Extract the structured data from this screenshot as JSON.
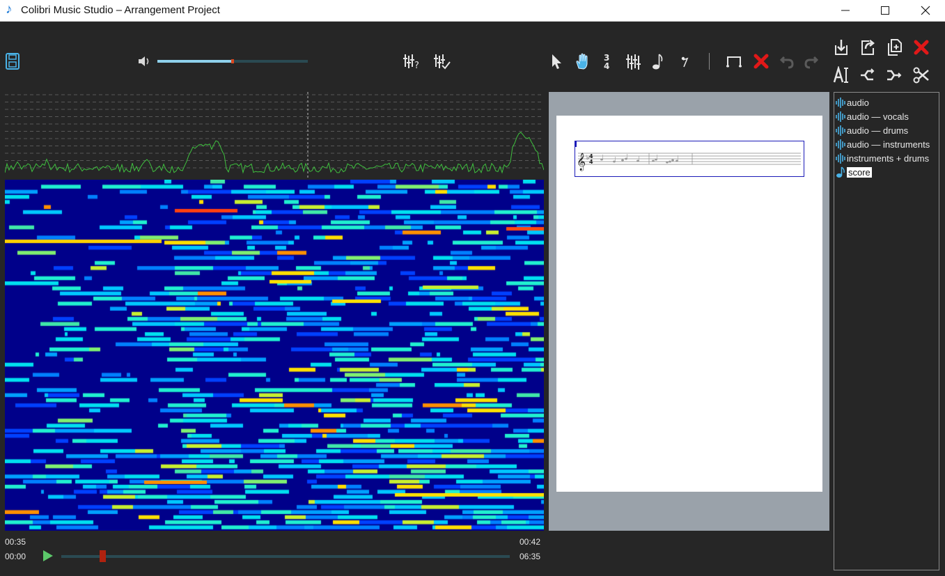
{
  "window": {
    "title": "Colibri Music Studio – Arrangement Project",
    "app_icon": "music-note-icon",
    "controls": [
      "minimize-icon",
      "maximize-icon",
      "close-icon"
    ]
  },
  "toolbar": {
    "volume_level": 0.5,
    "left_icons": [
      "save-icon",
      "volume-icon"
    ],
    "center_icons": [
      "tune-question-icon",
      "tune-check-icon"
    ],
    "tools": [
      "pointer-tool-icon",
      "hand-tool-icon",
      "time-signature-icon",
      "key-signature-icon",
      "note-icon",
      "rest-icon",
      "beam-icon",
      "delete-icon",
      "undo-icon",
      "redo-icon"
    ]
  },
  "right_toolbar": {
    "row1": [
      "import-icon",
      "export-icon",
      "copy-file-icon",
      "remove-icon"
    ],
    "row2": [
      "text-cursor-icon",
      "merge-icon",
      "split-icon",
      "cut-icon"
    ]
  },
  "tree": {
    "items": [
      {
        "label": "audio",
        "icon": "waveform-icon"
      },
      {
        "label": "audio — vocals",
        "icon": "waveform-icon"
      },
      {
        "label": "audio — drums",
        "icon": "waveform-icon"
      },
      {
        "label": "audio — instruments",
        "icon": "waveform-icon"
      },
      {
        "label": "instruments + drums",
        "icon": "waveform-icon"
      },
      {
        "label": "score",
        "icon": "note-icon",
        "selected": true
      }
    ]
  },
  "playback": {
    "view_start": "00:35",
    "view_end": "00:42",
    "current": "00:00",
    "total": "06:35",
    "progress": 0.09
  },
  "colors": {
    "accent": "#4ab3e8",
    "waveform": "#3fc03f",
    "spectro_bg": "#00008a",
    "delete": "#e01818",
    "seek_knob": "#b0220f"
  }
}
